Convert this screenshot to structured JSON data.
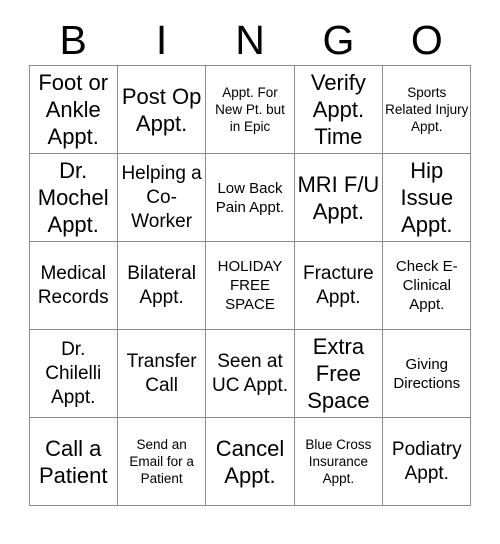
{
  "card": {
    "title": "BINGO Card",
    "header_letters": [
      "B",
      "I",
      "N",
      "G",
      "O"
    ],
    "columns": 5,
    "rows": 5,
    "grid_line_color": "#8c8c8c",
    "text_color": "#000000",
    "background_color": "#ffffff",
    "cells": [
      {
        "text": "Foot or Ankle Appt.",
        "size": "lg"
      },
      {
        "text": "Post Op Appt.",
        "size": "lg"
      },
      {
        "text": "Appt. For New Pt. but in Epic",
        "size": "xs"
      },
      {
        "text": "Verify Appt. Time",
        "size": "lg"
      },
      {
        "text": "Sports Related Injury Appt.",
        "size": "xs"
      },
      {
        "text": "Dr. Mochel Appt.",
        "size": "lg"
      },
      {
        "text": "Helping a Co-Worker",
        "size": "md"
      },
      {
        "text": "Low Back Pain Appt.",
        "size": "sm"
      },
      {
        "text": "MRI F/U Appt.",
        "size": "lg"
      },
      {
        "text": "Hip Issue Appt.",
        "size": "lg"
      },
      {
        "text": "Medical Records",
        "size": "md"
      },
      {
        "text": "Bilateral Appt.",
        "size": "md"
      },
      {
        "text": "HOLIDAY FREE SPACE",
        "size": "sm"
      },
      {
        "text": "Fracture Appt.",
        "size": "md"
      },
      {
        "text": "Check E-Clinical Appt.",
        "size": "sm"
      },
      {
        "text": "Dr. Chilelli Appt.",
        "size": "md"
      },
      {
        "text": "Transfer Call",
        "size": "md"
      },
      {
        "text": "Seen at UC Appt.",
        "size": "md"
      },
      {
        "text": "Extra Free Space",
        "size": "lg"
      },
      {
        "text": "Giving Directions",
        "size": "sm"
      },
      {
        "text": "Call a Patient",
        "size": "lg"
      },
      {
        "text": "Send an Email for a Patient",
        "size": "xs"
      },
      {
        "text": "Cancel Appt.",
        "size": "lg"
      },
      {
        "text": "Blue Cross Insurance Appt.",
        "size": "xs"
      },
      {
        "text": "Podiatry Appt.",
        "size": "md"
      }
    ]
  }
}
